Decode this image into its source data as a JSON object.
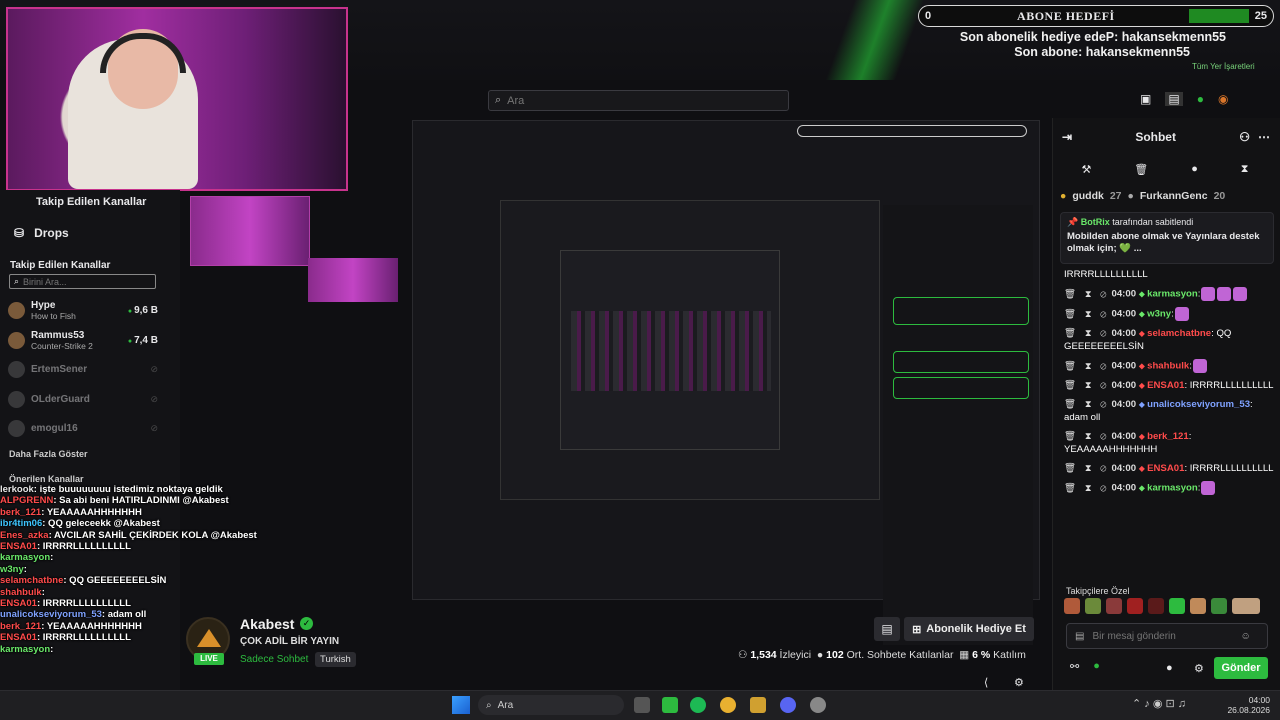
{
  "goal": {
    "left_num": "0",
    "title": "ABONE HEDEFİ",
    "right_num": "25"
  },
  "gift_line1": "Son abonelik hediye edeP: hakansekmenn55",
  "gift_line2": "Son abone: hakansekmenn55",
  "all_signs": "Tüm Yer İşaretleri",
  "search": {
    "placeholder": "Ara"
  },
  "sidebar": {
    "following_header": "Takip Edilen Kanallar",
    "drops": "Drops",
    "following_title": "Takip Edilen Kanallar",
    "search_placeholder": "Birini Ara...",
    "channels": [
      {
        "name": "Hype",
        "sub": "How to Fish",
        "viewers": "9,6 B",
        "live": true
      },
      {
        "name": "Rammus53",
        "sub": "Counter-Strike 2",
        "viewers": "7,4 B",
        "live": true
      },
      {
        "name": "ErtemSener",
        "sub": "",
        "viewers": "",
        "live": false
      },
      {
        "name": "OLderGuard",
        "sub": "",
        "viewers": "",
        "live": false
      },
      {
        "name": "emogul16",
        "sub": "",
        "viewers": "",
        "live": false
      }
    ],
    "show_more": "Daha Fazla Göster",
    "suggested": "Önerilen Kanallar"
  },
  "overlay_chat": [
    {
      "user": "lerkook",
      "color": "#e8e8e8",
      "text": ": işte buuuuuuuu istedimiz noktaya geldik"
    },
    {
      "user": "ALPGRENN",
      "color": "#ff4b4b",
      "text": ": Sa abi beni HATIRLADINMI @Akabest"
    },
    {
      "user": "berk_121",
      "color": "#ff4b4b",
      "text": ": YEAAAAAHHHHHHH"
    },
    {
      "user": "ibr4tim06",
      "color": "#3ec6ff",
      "text": ": QQ geleceekk @Akabest"
    },
    {
      "user": "Enes_azka",
      "color": "#ff4b4b",
      "text": ": AVCILAR SAHİL ÇEKİRDEK KOLA @Akabest"
    },
    {
      "user": "ENSA01",
      "color": "#ff4b4b",
      "text": ": IRRRRLLLLLLLLLL"
    },
    {
      "user": "karmasyon",
      "color": "#6ae86a",
      "text": ":"
    },
    {
      "user": "w3ny",
      "color": "#6ae86a",
      "text": ":"
    },
    {
      "user": "selamchatbne",
      "color": "#ff4b4b",
      "text": ": QQ GEEEEEEEELSİN"
    },
    {
      "user": "shahbulk",
      "color": "#ff4b4b",
      "text": ":"
    },
    {
      "user": "ENSA01",
      "color": "#ff4b4b",
      "text": ": IRRRRLLLLLLLLLL"
    },
    {
      "user": "unalicokseviyorum_53",
      "color": "#7fa2ff",
      "text": ": adam oll"
    },
    {
      "user": "berk_121",
      "color": "#ff4b4b",
      "text": ": YEAAAAAHHHHHHH"
    },
    {
      "user": "ENSA01",
      "color": "#ff4b4b",
      "text": ": IRRRRLLLLLLLLLL"
    },
    {
      "user": "karmasyon",
      "color": "#6ae86a",
      "text": ":"
    }
  ],
  "stream": {
    "name": "Akabest",
    "title": "ÇOK ADİL BİR YAYIN",
    "subonly": "Sadece Sohbet",
    "lang": "Turkish",
    "live": "LIVE",
    "sub_button": "Abonelik Hediye Et",
    "viewers": "1,534",
    "viewers_label": "İzleyici",
    "chatters": "102",
    "chatters_label": "Ort. Sohbete Katılanlar",
    "participation": "6 %",
    "participation_label": "Katılım"
  },
  "chat": {
    "title": "Sohbet",
    "top_gifters": [
      {
        "name": "guddk",
        "count": "27"
      },
      {
        "name": "FurkannGenc",
        "count": "20"
      }
    ],
    "pinned_by": "BotRix",
    "pinned_label": "tarafından sabitlendi",
    "pinned_text": "Mobilden abone olmak ve Yayınlara destek olmak için; 💚 ...",
    "messages": [
      {
        "time": "",
        "user": "",
        "color": "#ddd",
        "text": "IRRRRLLLLLLLLLL",
        "emotes": 0
      },
      {
        "time": "04:00",
        "user": "karmasyon",
        "color": "#6ae86a",
        "text": ":",
        "emotes": 3
      },
      {
        "time": "04:00",
        "user": "w3ny",
        "color": "#6ae86a",
        "text": ":",
        "emotes": 1
      },
      {
        "time": "04:00",
        "user": "selamchatbne",
        "color": "#ff4b4b",
        "text": ": QQ GEEEEEEEELSİN",
        "emotes": 0
      },
      {
        "time": "04:00",
        "user": "shahbulk",
        "color": "#ff4b4b",
        "text": ":",
        "emotes": 1
      },
      {
        "time": "04:00",
        "user": "ENSA01",
        "color": "#ff4b4b",
        "text": ": IRRRRLLLLLLLLLL",
        "emotes": 0
      },
      {
        "time": "04:00",
        "user": "unalicokseviyorum_53",
        "color": "#7fa2ff",
        "text": ": adam oll",
        "emotes": 0
      },
      {
        "time": "04:00",
        "user": "berk_121",
        "color": "#ff4b4b",
        "text": ": YEAAAAAHHHHHHH",
        "emotes": 0
      },
      {
        "time": "04:00",
        "user": "ENSA01",
        "color": "#ff4b4b",
        "text": ": IRRRRLLLLLLLLLL",
        "emotes": 0
      },
      {
        "time": "04:00",
        "user": "karmasyon",
        "color": "#6ae86a",
        "text": ":",
        "emotes": 1
      }
    ],
    "followers_only": "Takipçilere Özel",
    "input_placeholder": "Bir mesaj gönderin",
    "send": "Gönder"
  },
  "taskbar": {
    "search": "Ara",
    "time": "04:00",
    "date": "26.08.2026"
  },
  "colors": {
    "accent": "#2dbb3f",
    "cam_border": "#c8338d"
  }
}
